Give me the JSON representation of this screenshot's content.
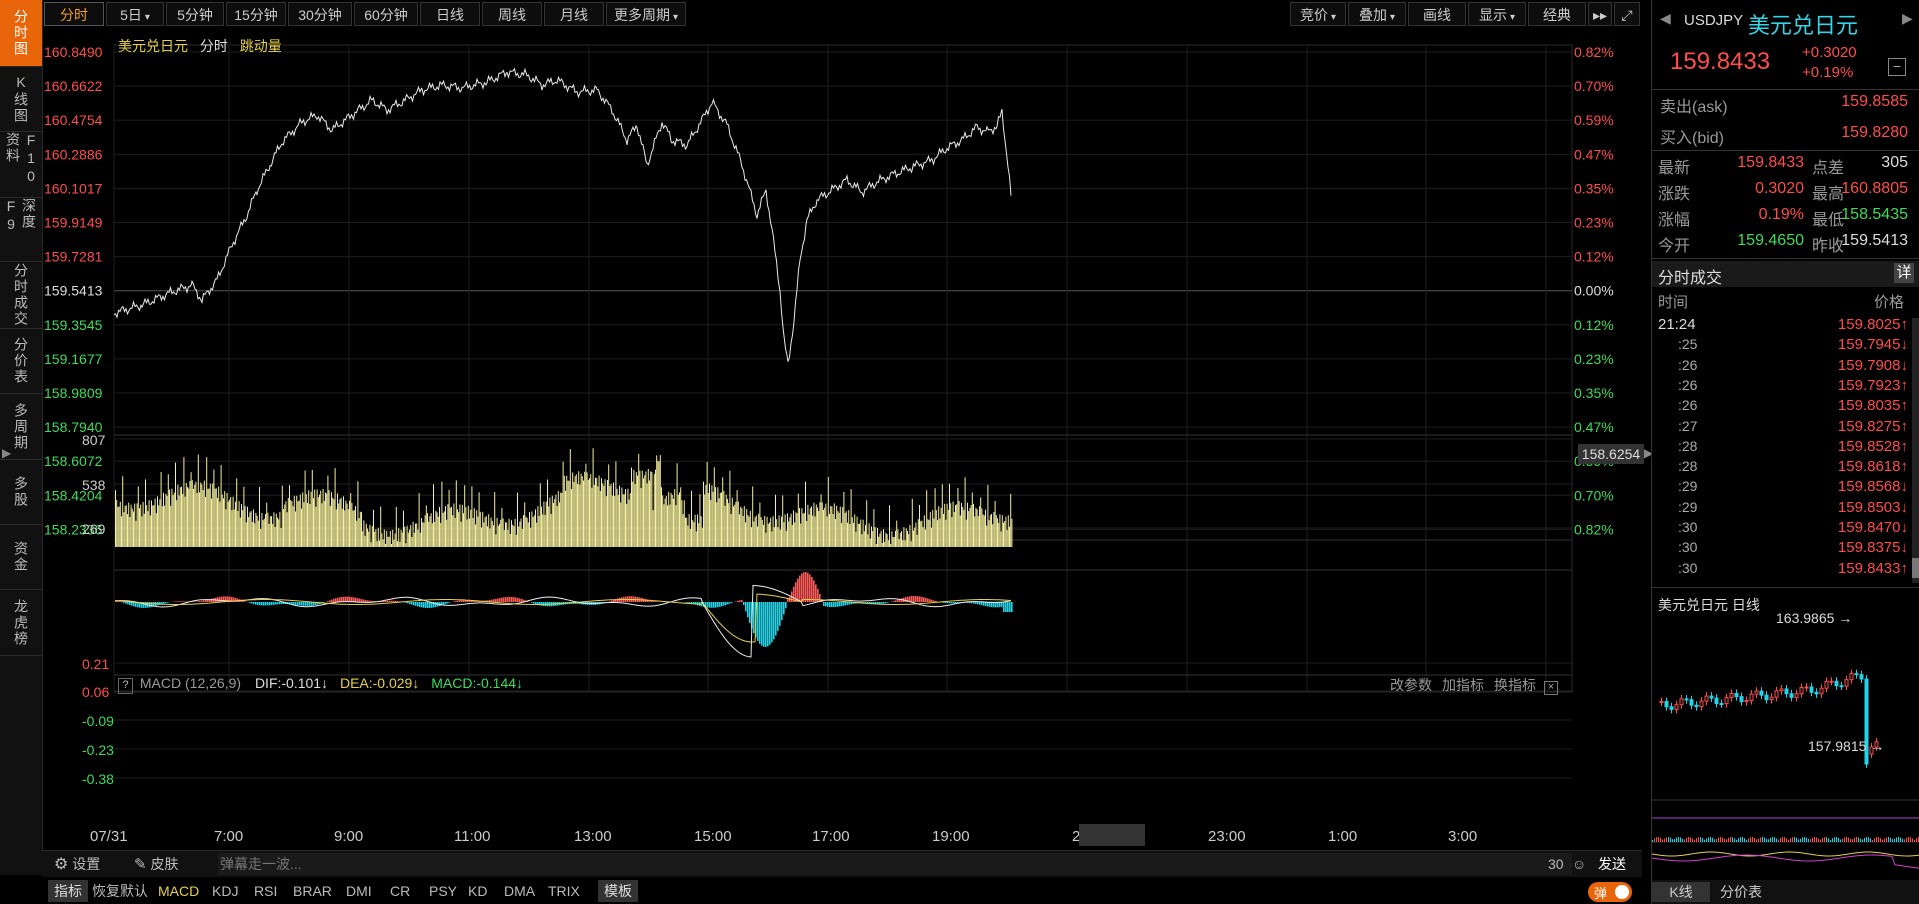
{
  "vtabs": [
    {
      "label": "分时图",
      "active": true
    },
    {
      "label": "K线图"
    },
    {
      "label": "F10资料"
    },
    {
      "label": "深度F9"
    },
    {
      "label": "分时成交"
    },
    {
      "label": "分价表"
    },
    {
      "label": "多周期"
    },
    {
      "label": "多股"
    },
    {
      "label": "资金"
    },
    {
      "label": "龙虎榜"
    }
  ],
  "toolbar": {
    "periods": [
      "分时",
      "5日",
      "5分钟",
      "15分钟",
      "30分钟",
      "60分钟",
      "日线",
      "周线",
      "月线",
      "更多周期"
    ],
    "right": [
      "竞价",
      "叠加",
      "画线",
      "显示",
      "经典"
    ],
    "forward_icon": "double-right-arrow-icon",
    "fullscreen_icon": "fullscreen-icon"
  },
  "chart_header": {
    "name": "美元兑日元",
    "mode": "分时",
    "extra": "跳动量"
  },
  "price_axis_left": [
    "160.8490",
    "160.6622",
    "160.4754",
    "160.2886",
    "160.1017",
    "159.9149",
    "159.7281",
    "159.5413",
    "159.3545",
    "159.1677",
    "158.9809",
    "158.7940",
    "158.6072",
    "158.4204",
    "158.2336"
  ],
  "price_axis_right": [
    "0.82%",
    "0.70%",
    "0.59%",
    "0.47%",
    "0.35%",
    "0.23%",
    "0.12%",
    "0.00%",
    "0.12%",
    "0.23%",
    "0.35%",
    "0.47%",
    "0.59%",
    "0.70%",
    "0.82%"
  ],
  "crosshair_price": "158.6254",
  "volume_axis": [
    "807",
    "538",
    "269"
  ],
  "macd": {
    "help": "?",
    "label": "MACD (12,26,9)",
    "dif": "DIF:-0.101↓",
    "dea": "DEA:-0.029↓",
    "macd": "MACD:-0.144↓",
    "actions": [
      "改参数",
      "加指标",
      "换指标"
    ],
    "axis": [
      "0.21",
      "0.06",
      "-0.09",
      "-0.23",
      "-0.38"
    ]
  },
  "time_axis": [
    "07/31",
    "7:00",
    "9:00",
    "11:00",
    "13:00",
    "15:00",
    "17:00",
    "19:00",
    "2",
    "20:50",
    "23:00",
    "1:00",
    "3:00"
  ],
  "bottom_bar": {
    "settings": "设置",
    "skin": "皮肤",
    "danmaku_placeholder": "弹幕走一波...",
    "count": "30",
    "send": "发送"
  },
  "indicator_tabs": [
    "指标",
    "恢复默认",
    "MACD",
    "KDJ",
    "RSI",
    "BRAR",
    "DMI",
    "CR",
    "PSY",
    "KD",
    "DMA",
    "TRIX",
    "模板"
  ],
  "danmaku_toggle": "弹",
  "quote": {
    "symbol": "USDJPY",
    "name": "美元兑日元",
    "price": "159.8433",
    "change": "+0.3020",
    "change_pct": "+0.19%",
    "ask_label": "卖出(ask)",
    "ask": "159.8585",
    "bid_label": "买入(bid)",
    "bid": "159.8280",
    "stats": [
      {
        "l1": "最新",
        "v1": "159.8433",
        "c1": "red",
        "l2": "点差",
        "v2": "305",
        "c2": "white"
      },
      {
        "l1": "涨跌",
        "v1": "0.3020",
        "c1": "red",
        "l2": "最高",
        "v2": "160.8805",
        "c2": "red"
      },
      {
        "l1": "涨幅",
        "v1": "0.19%",
        "c1": "red",
        "l2": "最低",
        "v2": "158.5435",
        "c2": "green"
      },
      {
        "l1": "今开",
        "v1": "159.4650",
        "c1": "green",
        "l2": "昨收",
        "v2": "159.5413",
        "c2": "white"
      }
    ]
  },
  "ticks": {
    "title": "分时成交",
    "detail": "详",
    "col_time": "时间",
    "col_price": "价格",
    "rows": [
      {
        "t": "21:24",
        "p": "159.8025↑",
        "d": "up"
      },
      {
        "t": ":25",
        "p": "159.7945↓",
        "d": "down"
      },
      {
        "t": ":26",
        "p": "159.7908↓",
        "d": "down"
      },
      {
        "t": ":26",
        "p": "159.7923↑",
        "d": "up"
      },
      {
        "t": ":26",
        "p": "159.8035↑",
        "d": "up"
      },
      {
        "t": ":27",
        "p": "159.8275↑",
        "d": "up"
      },
      {
        "t": ":28",
        "p": "159.8528↑",
        "d": "up"
      },
      {
        "t": ":28",
        "p": "159.8618↑",
        "d": "up"
      },
      {
        "t": ":29",
        "p": "159.8568↓",
        "d": "down"
      },
      {
        "t": ":29",
        "p": "159.8503↓",
        "d": "down"
      },
      {
        "t": ":30",
        "p": "159.8470↓",
        "d": "down"
      },
      {
        "t": ":30",
        "p": "159.8375↓",
        "d": "down"
      },
      {
        "t": ":30",
        "p": "159.8433↑",
        "d": "up"
      }
    ]
  },
  "mini_kline": {
    "title": "美元兑日元 日线",
    "high": "163.9865",
    "low": "157.9815"
  },
  "right_tabs": [
    "K线",
    "分价表"
  ],
  "colors": {
    "up": "#ff4d4d",
    "down": "#3ddc5a",
    "accent": "#e8650a",
    "volume": "#f5f0a0",
    "dea": "#e6d24a",
    "macd_up": "#ff5a5a",
    "macd_down": "#22d4e8"
  }
}
